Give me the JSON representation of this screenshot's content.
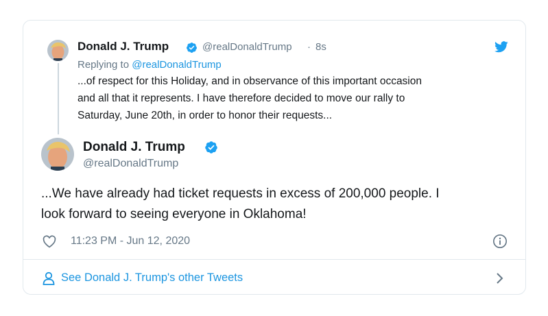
{
  "quoted_tweet": {
    "display_name": "Donald J. Trump",
    "handle": "@realDonaldTrump",
    "separator": "·",
    "time_ago": "8s",
    "replying_prefix": "Replying to",
    "replying_handle": "@realDonaldTrump",
    "text_lines": [
      "...of respect for this Holiday, and in observance of this important occasion",
      "and all that it represents. I have therefore decided to move our rally to",
      "Saturday, June 20th, in order to honor their requests..."
    ]
  },
  "main_tweet": {
    "display_name": "Donald J. Trump",
    "handle": "@realDonaldTrump",
    "text_lines": [
      "...We have already had ticket requests in excess of 200,000 people. I",
      "look forward to seeing everyone in Oklahoma!"
    ],
    "timestamp": "11:23 PM - Jun 12, 2020"
  },
  "footer": {
    "other_tweets_label": "See Donald J. Trump's other Tweets"
  },
  "icons": {
    "brand": "twitter-bird-icon",
    "verified": "verified-badge-icon",
    "like": "heart-icon",
    "info": "info-icon",
    "user": "user-icon",
    "chevron": "chevron-right-icon"
  },
  "colors": {
    "brand_blue": "#1da1f2",
    "link_blue": "#1b95e0",
    "muted_gray": "#657786",
    "border": "#e1e8ed"
  }
}
